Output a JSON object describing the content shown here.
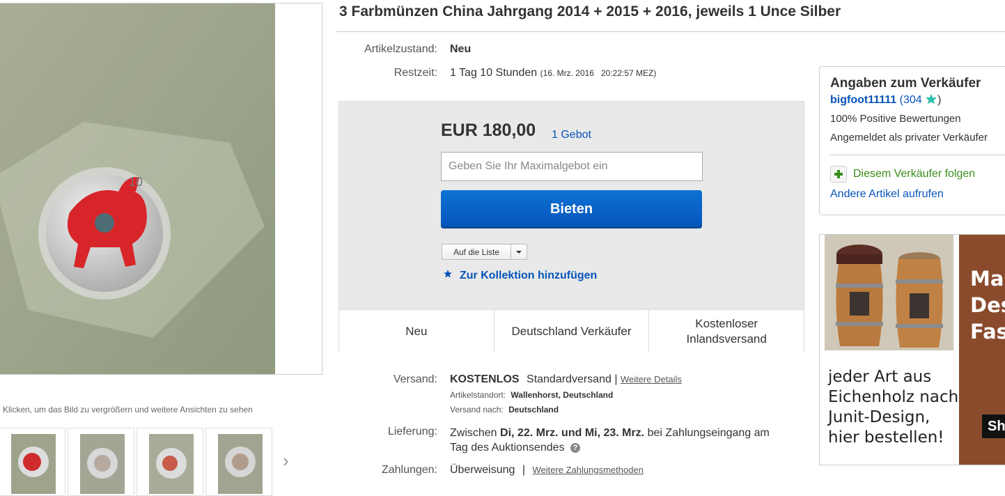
{
  "title": "3 Farbmünzen China Jahrgang 2014 + 2015 + 2016, jeweils 1 Unce Silber",
  "gallery": {
    "caption": "Klicken, um das Bild zu vergrößern und weitere Ansichten zu sehen",
    "next_arrow": "›"
  },
  "details": {
    "condition_label": "Artikelzustand:",
    "condition_value": "Neu",
    "time_label": "Restzeit:",
    "time_value": "1 Tag 10 Stunden",
    "time_end": "(16. Mrz. 2016   20:22:57 MEZ)"
  },
  "bid": {
    "price": "EUR 180,00",
    "bid_count": "1 Gebot",
    "max_bid_placeholder": "Geben Sie Ihr Maximalgebot ein",
    "bid_button": "Bieten",
    "watch_label": "Auf die Liste",
    "collection_label": "Zur Kollektion hinzufügen"
  },
  "features": [
    "Neu",
    "Deutschland Verkäufer",
    "Kostenloser Inlandsversand"
  ],
  "shipping": {
    "label": "Versand:",
    "free": "KOSTENLOS",
    "method": "Standardversand |",
    "details_link": "Weitere Details",
    "location_label": "Artikelstandort:",
    "location_value": "Wallenhorst, Deutschland",
    "ships_to_label": "Versand nach:",
    "ships_to_value": "Deutschland"
  },
  "delivery": {
    "label": "Lieferung:",
    "prefix": "Zwischen ",
    "dates": "Di, 22. Mrz. und Mi, 23. Mrz.",
    "suffix": " bei Zahlungseingang am",
    "line2": "Tag des Auktionsendes",
    "help_icon": "?"
  },
  "payment": {
    "label": "Zahlungen:",
    "value": "Überweisung",
    "separator": "|",
    "more_link": "Weitere Zahlungsmethoden"
  },
  "seller": {
    "heading": "Angaben zum Verkäufer",
    "username": "bigfoot11111",
    "feedback_open": "(",
    "feedback_score": "304",
    "feedback_close": ")",
    "positive": "100% Positive Bewertungen",
    "type": "Angemeldet als privater Verkäufer",
    "follow": "Diesem Verkäufer folgen",
    "other_items": "Andere Artikel aufrufen"
  },
  "ad": {
    "line1": "jeder Art aus",
    "line2": "Eichenholz nach",
    "line3": "Junit-Design,",
    "line4": "hier bestellen!",
    "side1": "Mas",
    "side2": "Des",
    "side3": "Fas",
    "button": "Sh"
  },
  "colors": {
    "link": "#0654ba",
    "bid_button": "#0654ba",
    "follow_green": "#3a8d1a",
    "star_teal": "#2fc0b0"
  }
}
